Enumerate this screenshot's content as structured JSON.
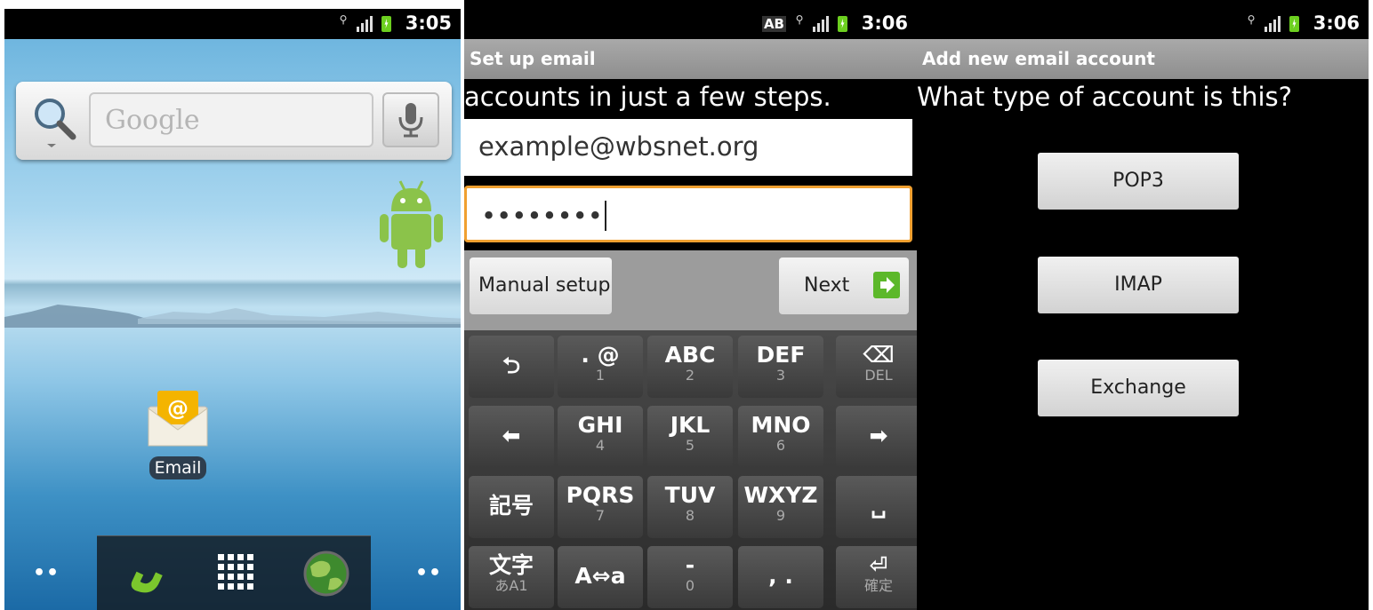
{
  "home": {
    "status": {
      "time": "3:05"
    },
    "search": {
      "placeholder": "Google"
    },
    "app": {
      "label": "Email"
    },
    "page_dots_left": "••",
    "page_dots_right": "••"
  },
  "setup": {
    "status": {
      "time": "3:06",
      "ime": "AB"
    },
    "title": "Set up email",
    "subtitle": "accounts in just a few steps.",
    "email_value": "example@wbsnet.org",
    "password_value": "••••••••",
    "manual_setup_label": "Manual setup",
    "next_label": "Next",
    "keyboard": {
      "rows": [
        [
          {
            "main": "⮌",
            "sub": ""
          },
          {
            "main": ". @",
            "sub": "1"
          },
          {
            "main": "ABC",
            "sub": "2"
          },
          {
            "main": "DEF",
            "sub": "3"
          },
          {
            "main": "⌫",
            "sub": "DEL"
          }
        ],
        [
          {
            "main": "⬅",
            "sub": ""
          },
          {
            "main": "GHI",
            "sub": "4"
          },
          {
            "main": "JKL",
            "sub": "5"
          },
          {
            "main": "MNO",
            "sub": "6"
          },
          {
            "main": "➡",
            "sub": ""
          }
        ],
        [
          {
            "main": "記号",
            "sub": ""
          },
          {
            "main": "PQRS",
            "sub": "7"
          },
          {
            "main": "TUV",
            "sub": "8"
          },
          {
            "main": "WXYZ",
            "sub": "9"
          },
          {
            "main": "␣",
            "sub": ""
          }
        ],
        [
          {
            "main": "文字",
            "sub": "あA1"
          },
          {
            "main": "A⇔a",
            "sub": ""
          },
          {
            "main": "-",
            "sub": "0"
          },
          {
            "main": ", .",
            "sub": ""
          },
          {
            "main": "⏎",
            "sub": "確定"
          }
        ]
      ]
    }
  },
  "account_type": {
    "status": {
      "time": "3:06"
    },
    "title": "Add new email account",
    "question": "What type of account is this?",
    "options": [
      "POP3",
      "IMAP",
      "Exchange"
    ]
  },
  "colors": {
    "focus_border": "#f0a030",
    "title_bar": "#9a9a9a",
    "next_arrow": "#5cb82a"
  }
}
